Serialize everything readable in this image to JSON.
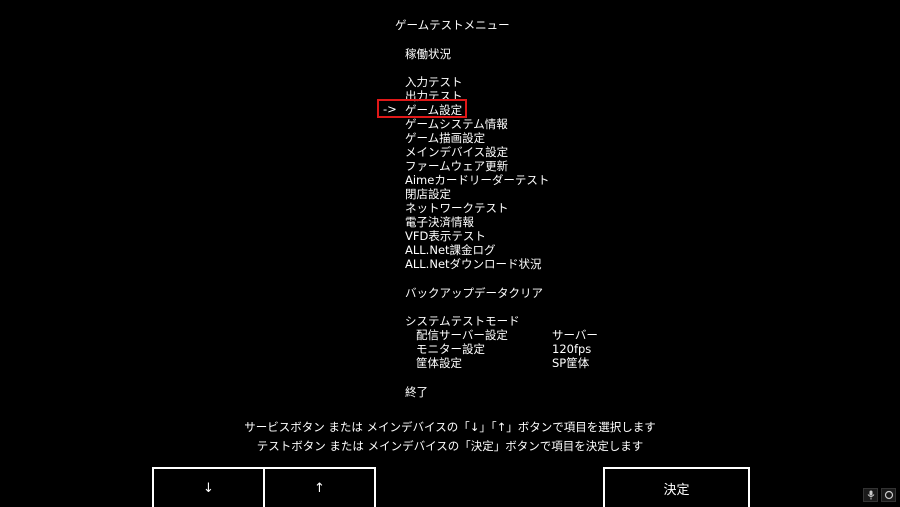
{
  "header": {
    "title": "ゲームテストメニュー"
  },
  "menu": {
    "cursor": "->",
    "items": [
      "稼働状況",
      "入力テスト",
      "出力テスト",
      "ゲーム設定",
      "ゲームシステム情報",
      "ゲーム描画設定",
      "メインデバイス設定",
      "ファームウェア更新",
      "Aimeカードリーダーテスト",
      "閉店設定",
      "ネットワークテスト",
      "電子決済情報",
      "VFD表示テスト",
      "ALL.Net課金ログ",
      "ALL.Netダウンロード状況",
      "バックアップデータクリア",
      "システムテストモード",
      "終了"
    ],
    "sub_items": [
      {
        "label": "配信サーバー設定",
        "value": "サーバー"
      },
      {
        "label": "モニター設定",
        "value": "120fps"
      },
      {
        "label": "筐体設定",
        "value": "SP筐体"
      }
    ],
    "selected_index": 3
  },
  "help": {
    "line1": "サービスボタン または メインデバイスの「↓」「↑」ボタンで項目を選択します",
    "line2": "テストボタン または メインデバイスの「決定」ボタンで項目を決定します"
  },
  "buttons": {
    "down": "↓",
    "up": "↑",
    "decide": "決定"
  },
  "colors": {
    "background": "#000000",
    "text": "#ffffff",
    "selection": "#e01818"
  },
  "tray_icons": [
    "microphone-icon",
    "circle-icon"
  ]
}
